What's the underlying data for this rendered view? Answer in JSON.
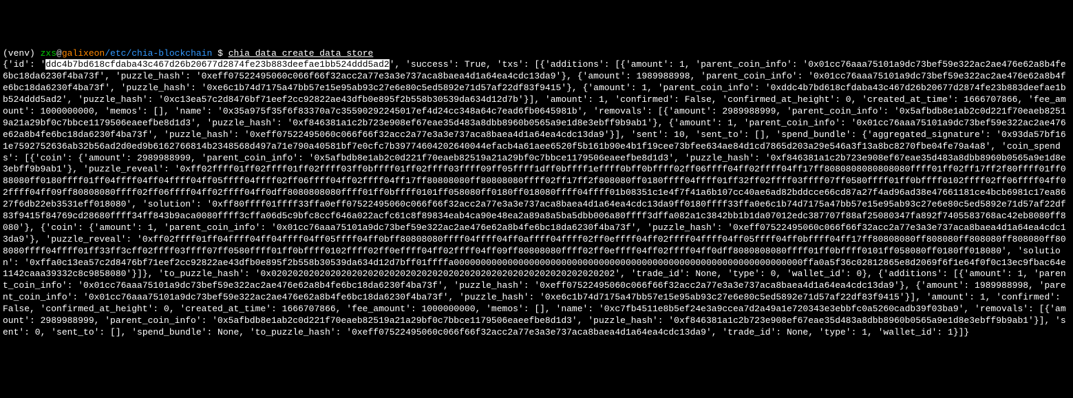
{
  "prompt": {
    "venv": "(venv) ",
    "user": "zxs",
    "at": "@",
    "host": "galixeon",
    "path": "/etc/chia-blockchain",
    "dollar": " $ ",
    "command": "chia data create_data_store"
  },
  "output": {
    "prefix": "{'id': '",
    "highlighted_id": "ddc4b7bd618cfdaba43c467d26b20677d2874fe23b883deefae1bb524ddd5ad2",
    "rest": "', 'success': True, 'txs': [{'additions': [{'amount': 1, 'parent_coin_info': '0x01cc76aaa75101a9dc73bef59e322ac2ae476e62a8b4fe6bc18da6230f4ba73f', 'puzzle_hash': '0xeff07522495060c066f66f32acc2a77e3a3e737aca8baea4d1a64ea4cdc13da9'}, {'amount': 1989988998, 'parent_coin_info': '0x01cc76aaa75101a9dc73bef59e322ac2ae476e62a8b4fe6bc18da6230f4ba73f', 'puzzle_hash': '0xe6c1b74d7175a47bb57e15e95ab93c27e6e80c5ed5892e71d57af22df83f9415'}, {'amount': 1, 'parent_coin_info': '0xddc4b7bd618cfdaba43c467d26b20677d2874fe23b883deefae1bb524ddd5ad2', 'puzzle_hash': '0xc13ea57c2d8476bf71eef2cc92822ae43dfb0e895f2b558b30539da634d12d7b'}], 'amount': 1, 'confirmed': False, 'confirmed_at_height': 0, 'created_at_time': 1666707866, 'fee_amount': 1000000000, 'memos': [], 'name': '0x35a975f35f6f83370a7c35590292245017ef4d24cc348a64c7ead6fb0645981b', 'removals': [{'amount': 2989988999, 'parent_coin_info': '0x5afbdb8e1ab2c0d221f70eaeb82519a21a29bf0c7bbce1179506eaeefbe8d1d3', 'puzzle_hash': '0xf846381a1c2b723e908ef67eae35d483a8dbb8960b0565a9e1d8e3ebff9b9ab1'}, {'amount': 1, 'parent_coin_info': '0x01cc76aaa75101a9dc73bef59e322ac2ae476e62a8b4fe6bc18da6230f4ba73f', 'puzzle_hash': '0xeff07522495060c066f66f32acc2a77e3a3e737aca8baea4d1a64ea4cdc13da9'}], 'sent': 10, 'sent_to': [], 'spend_bundle': {'aggregated_signature': '0x93da57bf161e7592752636ab32b56ad2d0ed9b6162766814b2348568d497a71e790a40581bf7e0cfc7b39774604202640044efacb4a61aee6520f5b161b90e4b1f19cee73bfee634ae84d1cd7865d203a29e546a3f13a8bc8270fbe04fe79a4a8', 'coin_spends': [{'coin': {'amount': 2989988999, 'parent_coin_info': '0x5afbdb8e1ab2c0d221f70eaeb82519a21a29bf0c7bbce1179506eaeefbe8d1d3', 'puzzle_hash': '0xf846381a1c2b723e908ef67eae35d483a8dbb8960b0565a9e1d8e3ebff9b9ab1'}, 'puzzle_reveal': '0xff02ffff01ff02ffff01ff02ffff03ff0bffff01ff02ffff03ffff09ff05ffff1dff0bffff1effff0bff0bffff02ff06ffff04ff02ffff04ff17ff8080808080808080ffff01ff02ff17ff2f80ffff01ff088080ff0180ffff01ff04ffff04ff04ffff04ff05ffff04ffff02ff06ffff04ff02ffff04ff17ff80808080ff80808080ffff02ff17ff2f808080ff0180ffff04ffff01ff32ff02ffff03ffff07ff0580ffff01ff0bffff0102ffff02ff06ffff04ff02ffff04ff09ff80808080ffff02ff06ffff04ff02ffff04ff0dff8080808080ffff01ff0bffff0101ff058080ff0180ff018080ffff04ffff01b08351c1e4f7f41a6b107cc40ae6ad82bddcce66cd87a27f4ad96ad38e47661181ce4bcb6981c17ea8627f6db22eb3531eff018080', 'solution': '0xff80ffff01ffff33ffa0eff07522495060c066f66f32acc2a77e3a3e737aca8baea4d1a64ea4cdc13da9ff0180ffff33ffa0e6c1b74d7175a47bb57e15e95ab93c27e6e80c5ed5892e71d57af22df83f9415f84769cd28680ffff34ff843b9aca0080ffff3cffa06d5c9bfc8ccf646a022acfc61c8f89834eab4ca90e48ea2a89a8a5ba5dbb006a80ffff3dffa082a1c3842bb1b1da07012edc387707f88af25080347fa892f7405583768ac42eb8080ff8080'}, {'coin': {'amount': 1, 'parent_coin_info': '0x01cc76aaa75101a9dc73bef59e322ac2ae476e62a8b4fe6bc18da6230f4ba73f', 'puzzle_hash': '0xeff07522495060c066f66f32acc2a77e3a3e737aca8baea4d1a64ea4cdc13da9'}, 'puzzle_reveal': '0xff02ffff01ff04ffff04ff04ffff04ff05ffff04ff0bff80808080ffff04ffff04ff0affff04ffff02ff0effff04ff02ffff04ffff04ff05ffff04ff0bffff04ff17ff80808080ff808080ff808080ff808080ff808080ffff04ffff01ff33ff3cff02ffff03ffff07ff0580ffff01ff0bffff0102ffff02ff0effff04ff02ffff04ff09ff80808080ffff02ff0effff04ff02ffff04ff0dff8080808080ffff01ff0bffff0101ff058080ff0180ff018080', 'solution': '0xffa0c13ea57c2d8476bf71eef2cc92822ae43dfb0e895f2b558b30539da634d12d7bff01ffffa00000000000000000000000000000000000000000000000000000000000000000ffa0a5f36c02812865e8d2069f6f1e64f0f0c13ec9fbac64e1142caaa39332c8c9858080'}]}, 'to_puzzle_hash': '0x0202020202020202020202020202020202020202020202020202020202020202', 'trade_id': None, 'type': 0, 'wallet_id': 0}, {'additions': [{'amount': 1, 'parent_coin_info': '0x01cc76aaa75101a9dc73bef59e322ac2ae476e62a8b4fe6bc18da6230f4ba73f', 'puzzle_hash': '0xeff07522495060c066f66f32acc2a77e3a3e737aca8baea4d1a64ea4cdc13da9'}, {'amount': 1989988998, 'parent_coin_info': '0x01cc76aaa75101a9dc73bef59e322ac2ae476e62a8b4fe6bc18da6230f4ba73f', 'puzzle_hash': '0xe6c1b74d7175a47bb57e15e95ab93c27e6e80c5ed5892e71d57af22df83f9415'}], 'amount': 1, 'confirmed': False, 'confirmed_at_height': 0, 'created_at_time': 1666707866, 'fee_amount': 1000000000, 'memos': [], 'name': '0xc7fb4511e8b5ef24e3a9ccea7d2a49a1e720343e3ebbfc0a5260cadb39f03ba9', 'removals': [{'amount': 2989988999, 'parent_coin_info': '0x5afbdb8e1ab2c0d221f70eaeb82519a21a29bf0c7bbce1179506eaeefbe8d1d3', 'puzzle_hash': '0xf846381a1c2b723e908ef67eae35d483a8dbb8960b0565a9e1d8e3ebff9b9ab1'}], 'sent': 0, 'sent_to': [], 'spend_bundle': None, 'to_puzzle_hash': '0xeff07522495060c066f66f32acc2a77e3a3e737aca8baea4d1a64ea4cdc13da9', 'trade_id': None, 'type': 1, 'wallet_id': 1}]}"
  }
}
